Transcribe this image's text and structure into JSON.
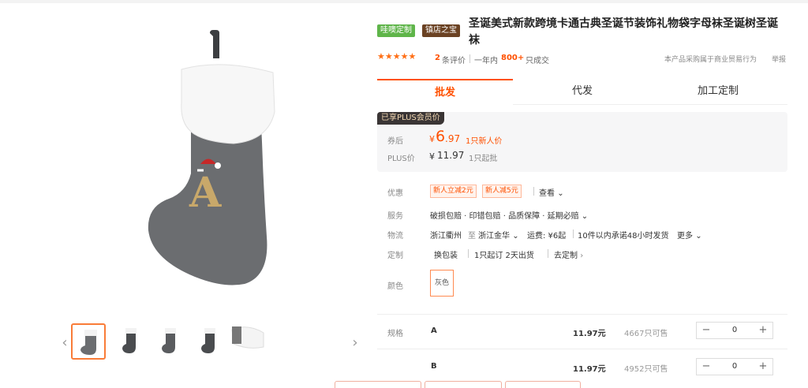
{
  "product": {
    "badge_1": "哇噢定制",
    "badge_2": "镇店之宝",
    "title": "圣诞美式新款跨境卡通古典圣诞节装饰礼物袋字母袜圣诞树圣诞袜"
  },
  "rating": {
    "stars": "★★★★★",
    "review_count": "2",
    "review_label": "条评价",
    "period_label": "一年内",
    "sold_count": "800+",
    "sold_label": "只成交",
    "notice": "本产品采购属于商业贸易行为",
    "report": "举报"
  },
  "tabs": [
    "批发",
    "代发",
    "加工定制"
  ],
  "price": {
    "plus_tag": "已享PLUS会员价",
    "after_coupon_label": "券后",
    "currency": "¥",
    "after_coupon_int": "6",
    "after_coupon_dec": ".97",
    "after_coupon_note": "1只新人价",
    "plus_label": "PLUS价",
    "plus_price": "11.97",
    "plus_note": "1只起批"
  },
  "details": {
    "discount_label": "优惠",
    "discount_chips": [
      "新人立减2元",
      "新人减5元"
    ],
    "discount_more": "查看",
    "service_label": "服务",
    "service_value": "破损包赔 · 印错包赔 · 品质保障 · 延期必赔",
    "logistics_label": "物流",
    "logistics_from": "浙江衢州",
    "logistics_to_word": "至",
    "logistics_to": "浙江金华",
    "logistics_fee": "运费: ¥6起",
    "logistics_promise": "10件以内承诺48小时发货",
    "logistics_more": "更多",
    "custom_label": "定制",
    "custom_option": "换包装",
    "custom_terms": "1只起订 2天出货",
    "custom_link": "去定制",
    "color_label": "颜色",
    "color_value": "灰色"
  },
  "skus": {
    "label": "规格",
    "items": [
      {
        "name": "A",
        "price": "11.97元",
        "stock": "4667只可售",
        "qty": "0"
      },
      {
        "name": "B",
        "price": "11.97元",
        "stock": "4952只可售",
        "qty": "0"
      }
    ],
    "minus": "−",
    "plus": "+"
  },
  "colors": {
    "accent": "#ff5000",
    "stocking_body": "#6b6d70",
    "stocking_cuff": "#ffffff",
    "letter_gold": "#c8a86a"
  },
  "icons": [
    "chevron-left-icon",
    "chevron-right-icon",
    "chevron-down-icon",
    "chevron-right-small-icon"
  ]
}
